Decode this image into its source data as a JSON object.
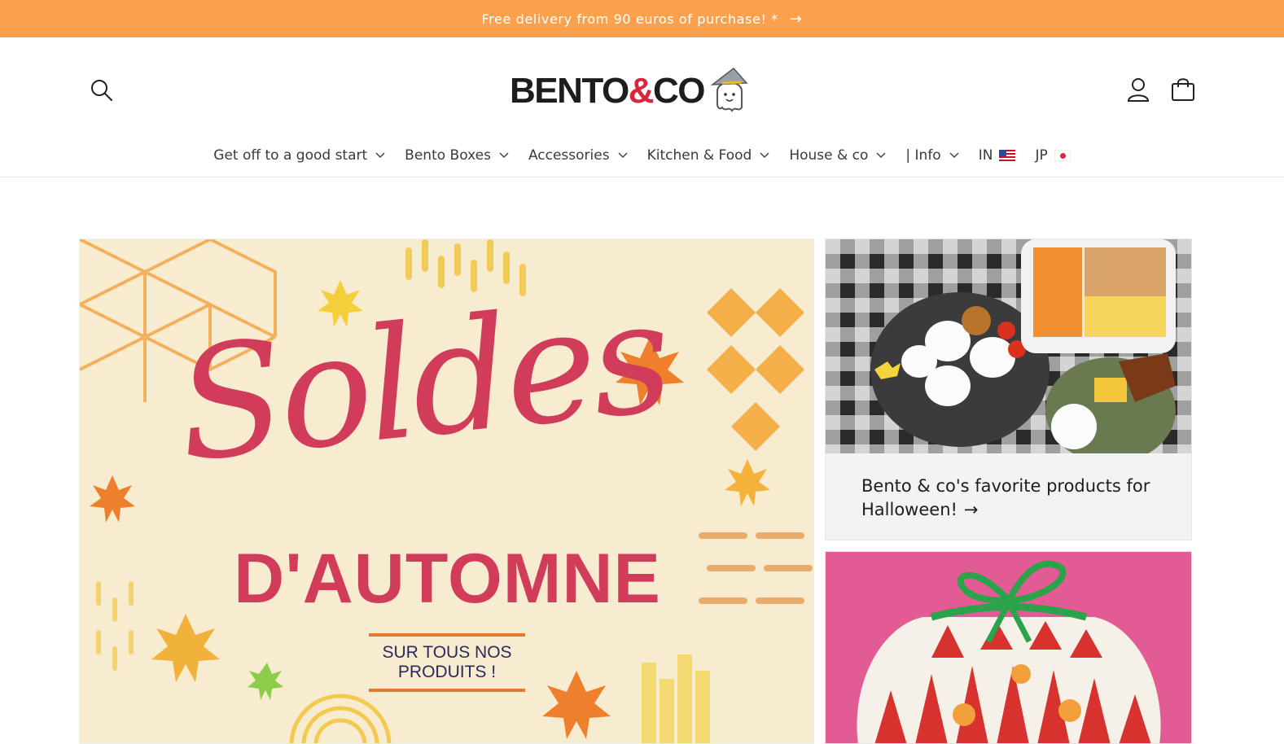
{
  "announcement": {
    "text": "Free delivery from 90 euros of purchase! *",
    "arrow": "→"
  },
  "header": {
    "logo": {
      "prefix": "BENTO",
      "amp": "&",
      "suffix": "CO"
    },
    "icons": {
      "search": "search-icon",
      "account": "user-icon",
      "cart": "bag-icon"
    }
  },
  "nav": {
    "items": [
      {
        "label": "Get off to a good start"
      },
      {
        "label": "Bento Boxes"
      },
      {
        "label": "Accessories"
      },
      {
        "label": "Kitchen & Food"
      },
      {
        "label": "House & co"
      },
      {
        "label": "| Info"
      }
    ],
    "languages": [
      {
        "label": "IN"
      },
      {
        "label": "JP"
      }
    ]
  },
  "hero": {
    "script": "Soldes",
    "title": "D'AUTOMNE",
    "subtitle_line1": "SUR TOUS NOS",
    "subtitle_line2": "PRODUITS !"
  },
  "cards": [
    {
      "title": "Bento & co's favorite products for Halloween!",
      "arrow": "→"
    }
  ],
  "colors": {
    "announcement_bg": "#fba14e",
    "brand_red": "#d13c5b",
    "card_bg": "#f3f3f3",
    "pink_bg": "#e35b95"
  }
}
